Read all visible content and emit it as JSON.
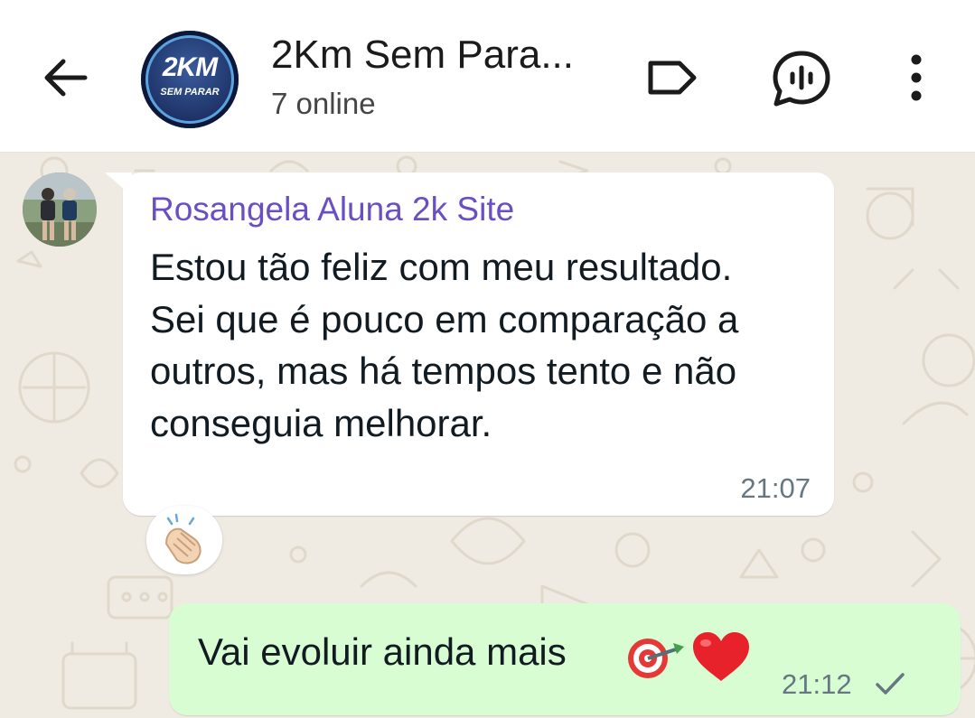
{
  "header": {
    "group_name": "2Km Sem Para...",
    "status": "7 online",
    "avatar_text_main": "2KM",
    "avatar_text_sub": "SEM PARAR"
  },
  "icons": {
    "back": "arrow-left-icon",
    "label": "label-tag-icon",
    "voice_chat": "voice-chat-icon",
    "more": "more-vertical-icon",
    "reaction": "clapping-hands-emoji",
    "target": "direct-hit-emoji",
    "heart": "red-heart-emoji",
    "read": "single-check-icon"
  },
  "messages": [
    {
      "direction": "incoming",
      "sender": "Rosangela Aluna 2k Site",
      "text": "Estou tão feliz com meu resultado. Sei que é pouco em comparação a outros, mas há tempos tento e não conseguia melhorar.",
      "time": "21:07",
      "reaction": "👏🏻"
    },
    {
      "direction": "outgoing",
      "text": "Vai evoluir ainda mais",
      "time": "21:12"
    }
  ],
  "colors": {
    "sender_name": "#6a4fc4",
    "incoming_bubble": "#ffffff",
    "outgoing_bubble": "#d9fdd3",
    "chat_background": "#efeae2",
    "timestamp": "#667781"
  }
}
